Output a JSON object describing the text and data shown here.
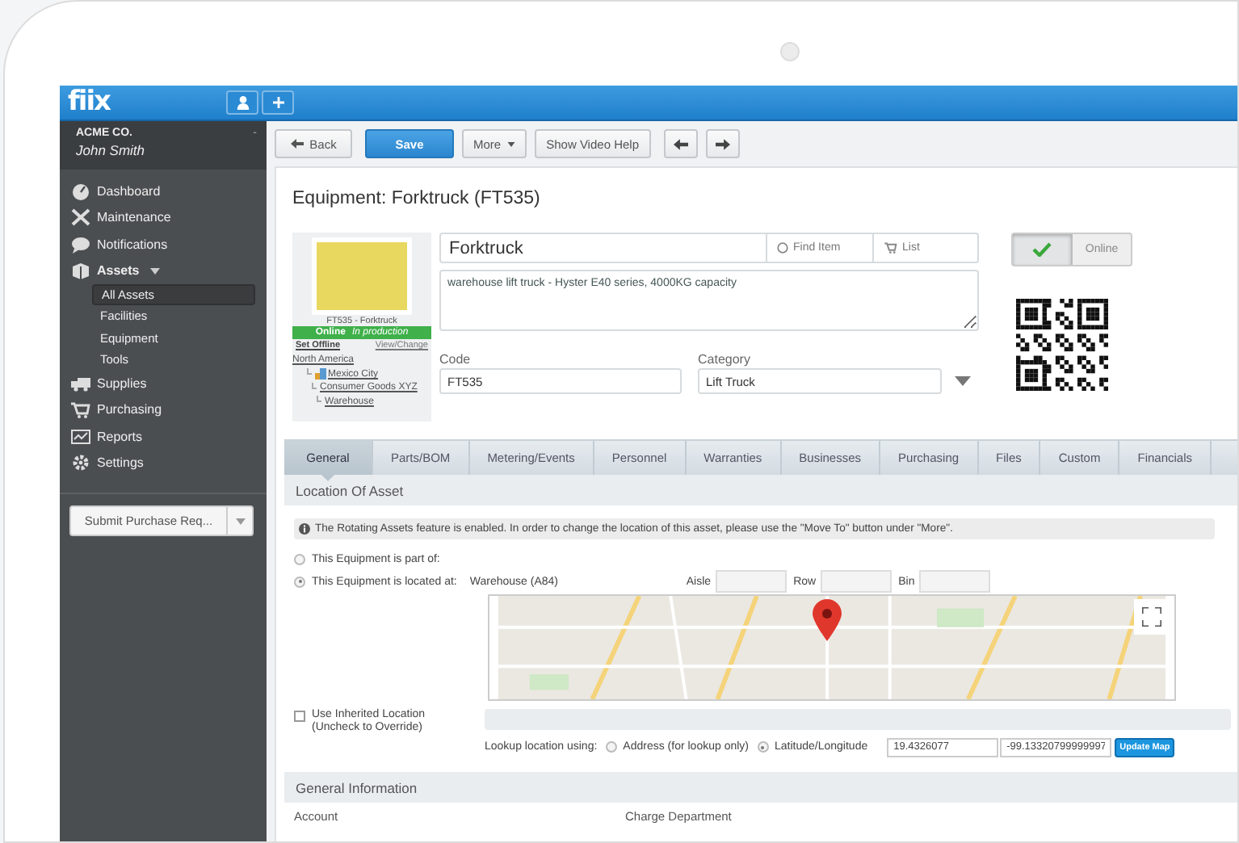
{
  "app_bar": {
    "logo": "fiix"
  },
  "account": {
    "company": "ACME CO.",
    "user": "John Smith",
    "marker": "-"
  },
  "sidebar": {
    "items": [
      {
        "label": "Dashboard",
        "selected": false
      },
      {
        "label": "Maintenance",
        "selected": false
      },
      {
        "label": "Notifications",
        "selected": false
      },
      {
        "label": "Assets",
        "selected": false,
        "expanded": true,
        "children": [
          {
            "label": "All Assets",
            "selected": true
          },
          {
            "label": "Facilities",
            "selected": false
          },
          {
            "label": "Equipment",
            "selected": false
          },
          {
            "label": "Tools",
            "selected": false
          }
        ]
      },
      {
        "label": "Supplies",
        "selected": false
      },
      {
        "label": "Purchasing",
        "selected": false
      },
      {
        "label": "Reports",
        "selected": false
      },
      {
        "label": "Settings",
        "selected": false
      }
    ],
    "button": "Submit Purchase Req..."
  },
  "toolbar": {
    "buttons": [
      {
        "kind": "back",
        "label": "Back"
      },
      {
        "kind": "primary",
        "label": "Save"
      },
      {
        "kind": "menu",
        "label": "More"
      },
      {
        "kind": "plain",
        "label": "Show Video Help"
      },
      {
        "kind": "prev"
      },
      {
        "kind": "next"
      }
    ]
  },
  "page_title": "Equipment: Forktruck (FT535)",
  "asset_card": {
    "caption": "FT535 - Forktruck",
    "status": "Online",
    "status_note": "In production",
    "set_offline": "Set Offline",
    "view_change": "View/Change",
    "location_tree": [
      {
        "label": "North America",
        "children": [
          {
            "label": "Mexico City",
            "children": [
              {
                "label": "Consumer Goods XYZ",
                "children": [
                  {
                    "label": "Warehouse"
                  }
                ]
              }
            ]
          }
        ]
      }
    ]
  },
  "form": {
    "name": "Forktruck",
    "find_item": "Find Item",
    "list": "List",
    "description": "warehouse lift truck - Hyster E40 series, 4000KG capacity",
    "code_label": "Code",
    "code": "FT535",
    "category_label": "Category",
    "category": "Lift Truck"
  },
  "online_toggle": {
    "label": "Online",
    "on": true
  },
  "tabs": [
    {
      "label": "General",
      "selected": true
    },
    {
      "label": "Parts/BOM",
      "selected": false
    },
    {
      "label": "Metering/Events",
      "selected": false
    },
    {
      "label": "Personnel",
      "selected": false
    },
    {
      "label": "Warranties",
      "selected": false
    },
    {
      "label": "Businesses",
      "selected": false
    },
    {
      "label": "Purchasing",
      "selected": false
    },
    {
      "label": "Files",
      "selected": false
    },
    {
      "label": "Custom",
      "selected": false
    },
    {
      "label": "Financials",
      "selected": false
    }
  ],
  "location_section": {
    "title": "Location Of Asset",
    "notice": "The Rotating Assets feature is enabled. In order to change the location of this asset, please use the \"Move To\" button under \"More\".",
    "options": [
      {
        "label": "This Equipment is part of:",
        "selected": false
      },
      {
        "label": "This Equipment is located at:",
        "selected": true
      }
    ],
    "location": "Warehouse (A84)",
    "aisle_label": "Aisle",
    "row_label": "Row",
    "bin_label": "Bin",
    "inherit": {
      "label": "Use Inherited Location",
      "note": "(Uncheck to Override)",
      "checked": false
    },
    "lookup_label": "Lookup location using:",
    "lookup_options": [
      {
        "label": "Address (for lookup only)",
        "selected": false
      },
      {
        "label": "Latitude/Longitude",
        "selected": true
      }
    ],
    "latitude": "19.4326077",
    "longitude": "-99.13320799999997",
    "update_button": "Update Map"
  },
  "general_section": {
    "title": "General Information",
    "fields": [
      "Account",
      "Charge Department"
    ]
  }
}
